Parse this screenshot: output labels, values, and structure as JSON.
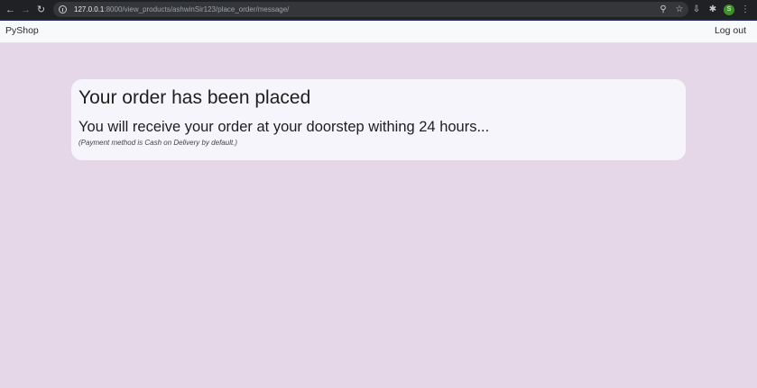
{
  "browser": {
    "url_host": "127.0.0.1",
    "url_rest": ":8000/view_products/ashwinSir123/place_order/message/",
    "avatar_letter": "S"
  },
  "navbar": {
    "brand": "PyShop",
    "logout": "Log out"
  },
  "message": {
    "title": "Your order has been placed",
    "subtitle": "You will receive your order at your doorstep withing 24 hours...",
    "note": "(Payment method is Cash on Delivery by default.)"
  }
}
